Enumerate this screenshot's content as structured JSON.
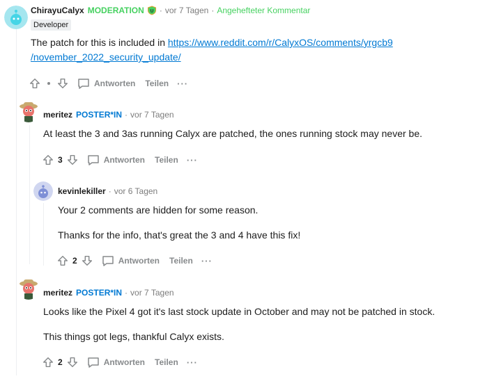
{
  "comments": [
    {
      "author": "ChirayuCalyx",
      "badge": "MODERATION",
      "time": "vor 7 Tagen",
      "pinned": "Angehefteter Kommentar",
      "flair": "Developer",
      "body_prefix": "The patch for this is included in ",
      "link_line1": "https://www.reddit.com/r/CalyxOS/comments/yrgcb9",
      "link_line2": "/november_2022_security_update/",
      "vote_count": "",
      "reply_label": "Antworten",
      "share_label": "Teilen",
      "more_label": "···"
    },
    {
      "author": "meritez",
      "badge": "POSTER*IN",
      "time": "vor 7 Tagen",
      "body": [
        "At least the 3 and 3as running Calyx are patched, the ones running stock may never be."
      ],
      "vote_count": "3",
      "reply_label": "Antworten",
      "share_label": "Teilen",
      "more_label": "···"
    },
    {
      "author": "kevinlekiller",
      "time": "vor 6 Tagen",
      "body": [
        "Your 2 comments are hidden for some reason.",
        "Thanks for the info, that's great the 3 and 4 have this fix!"
      ],
      "vote_count": "2",
      "reply_label": "Antworten",
      "share_label": "Teilen",
      "more_label": "···"
    },
    {
      "author": "meritez",
      "badge": "POSTER*IN",
      "time": "vor 7 Tagen",
      "body": [
        "Looks like the Pixel 4 got it's last stock update in October and may not be patched in stock.",
        "This things got legs, thankful Calyx exists."
      ],
      "vote_count": "2",
      "reply_label": "Antworten",
      "share_label": "Teilen",
      "more_label": "···"
    }
  ],
  "sep": "·",
  "colors": {
    "mod": "#46d160",
    "op": "#0079d3",
    "link": "#0079d3",
    "muted": "#878a8c"
  }
}
